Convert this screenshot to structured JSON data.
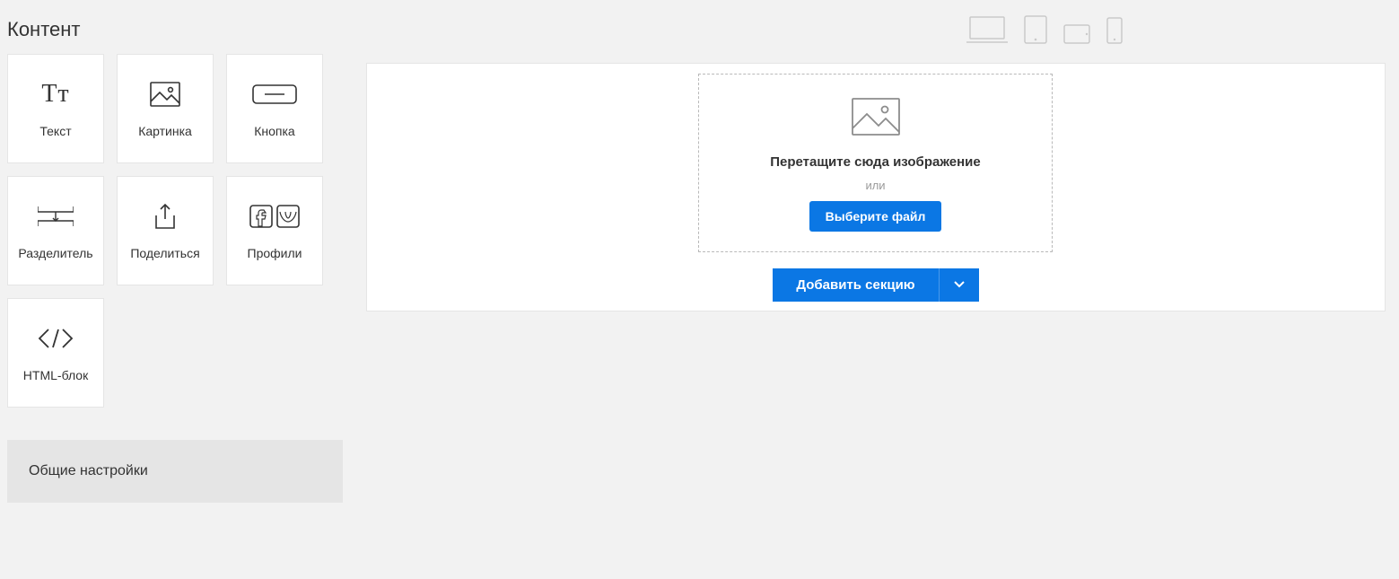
{
  "header": {
    "title": "Контент"
  },
  "blocks": [
    {
      "label": "Текст"
    },
    {
      "label": "Картинка"
    },
    {
      "label": "Кнопка"
    },
    {
      "label": "Разделитель"
    },
    {
      "label": "Поделиться"
    },
    {
      "label": "Профили"
    },
    {
      "label": "HTML-блок"
    }
  ],
  "general_settings_label": "Общие настройки",
  "dropzone": {
    "title": "Перетащите сюда изображение",
    "or": "или",
    "choose_file": "Выберите файл"
  },
  "add_section_label": "Добавить секцию"
}
